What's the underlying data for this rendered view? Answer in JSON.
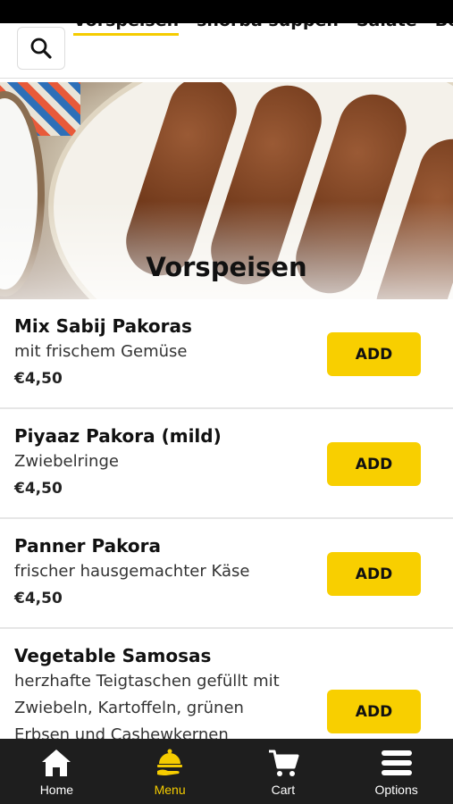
{
  "header": {
    "search_icon": "search-icon",
    "categories": [
      {
        "label": "Vorspeisen",
        "active": true
      },
      {
        "label": "shorba suppen",
        "active": false
      },
      {
        "label": "Salate",
        "active": false
      },
      {
        "label": "Beil",
        "active": false
      }
    ]
  },
  "hero": {
    "title": "Vorspeisen"
  },
  "menu_items": [
    {
      "name": "Mix Sabij Pakoras",
      "description": "mit frischem Gemüse",
      "price": "€4,50",
      "button": "ADD"
    },
    {
      "name": "Piyaaz Pakora (mild)",
      "description": "Zwiebelringe",
      "price": "€4,50",
      "button": "ADD"
    },
    {
      "name": "Panner Pakora",
      "description": "frischer hausgemachter Käse",
      "price": "€4,50",
      "button": "ADD"
    },
    {
      "name": "Vegetable Samosas",
      "description": "herzhafte Teigtaschen gefüllt mit Zwiebeln, Kartoffeln, grünen Erbsen und Cashewkernen",
      "price": "",
      "button": "ADD"
    }
  ],
  "bottom_nav": [
    {
      "label": "Home",
      "icon": "home-icon",
      "active": false
    },
    {
      "label": "Menu",
      "icon": "menu-cloche-icon",
      "active": true
    },
    {
      "label": "Cart",
      "icon": "cart-icon",
      "active": false
    },
    {
      "label": "Options",
      "icon": "hamburger-icon",
      "active": false
    }
  ],
  "colors": {
    "accent": "#f8cf00",
    "nav_bg": "#1e1e1e",
    "status_bar": "#000000"
  }
}
